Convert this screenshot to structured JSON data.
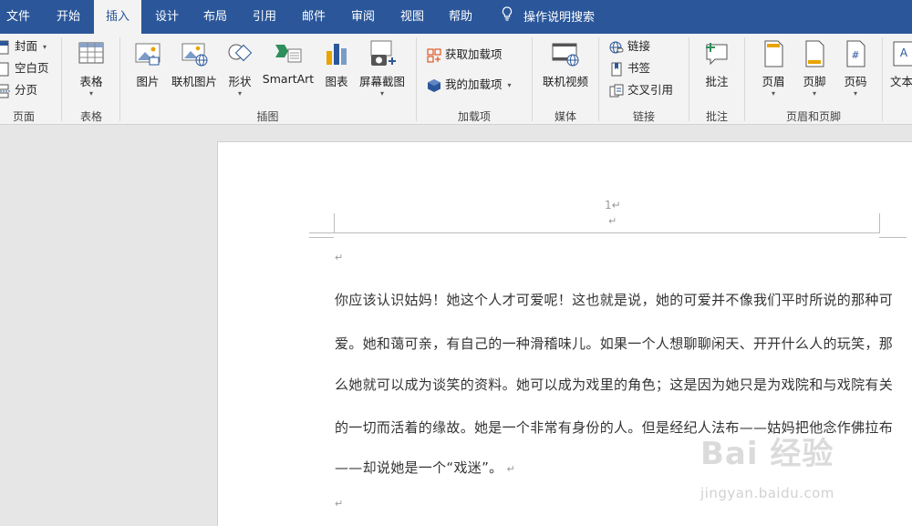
{
  "tabs": [
    {
      "label": "文件",
      "active": false
    },
    {
      "label": "开始",
      "active": false
    },
    {
      "label": "插入",
      "active": true
    },
    {
      "label": "设计",
      "active": false
    },
    {
      "label": "布局",
      "active": false
    },
    {
      "label": "引用",
      "active": false
    },
    {
      "label": "邮件",
      "active": false
    },
    {
      "label": "审阅",
      "active": false
    },
    {
      "label": "视图",
      "active": false
    },
    {
      "label": "帮助",
      "active": false
    }
  ],
  "tell_me": "操作说明搜索",
  "ribbon": {
    "pages": {
      "label": "页面",
      "cover": "封面",
      "blank": "空白页",
      "break": "分页"
    },
    "tables": {
      "label": "表格",
      "table": "表格"
    },
    "illustrations": {
      "label": "插图",
      "picture": "图片",
      "online_picture": "联机图片",
      "shapes": "形状",
      "smartart": "SmartArt",
      "chart": "图表",
      "screenshot": "屏幕截图"
    },
    "addins": {
      "label": "加载项",
      "get": "获取加载项",
      "mine": "我的加载项"
    },
    "media": {
      "label": "媒体",
      "online_video": "联机视频"
    },
    "links": {
      "label": "链接",
      "link": "链接",
      "bookmark": "书签",
      "cross_ref": "交叉引用"
    },
    "comments": {
      "label": "批注",
      "comment": "批注"
    },
    "header_footer": {
      "label": "页眉和页脚",
      "header": "页眉",
      "footer": "页脚",
      "page_number": "页码"
    },
    "text": {
      "textbox": "文本"
    }
  },
  "document": {
    "header_page_number": "1",
    "paragraph_lines": [
      "你应该认识姑妈！她这个人才可爱呢！这也就是说，她的可爱并不像我们平时所说的那种可",
      "爱。她和蔼可亲，有自己的一种滑稽味儿。如果一个人想聊聊闲天、开开什么人的玩笑，那",
      "么她就可以成为谈笑的资料。她可以成为戏里的角色；这是因为她只是为戏院和与戏院有关",
      "的一切而活着的缘故。她是一个非常有身份的人。但是经纪人法布——姑妈把他念作佛拉布",
      "——却说她是一个“戏迷”。"
    ]
  },
  "watermark": {
    "text": "Bai 经验",
    "url": "jingyan.baidu.com"
  },
  "colors": {
    "tab_bar": "#2b579a",
    "ribbon": "#f3f3f3",
    "page": "#ffffff",
    "workspace": "#e6e6e6"
  }
}
